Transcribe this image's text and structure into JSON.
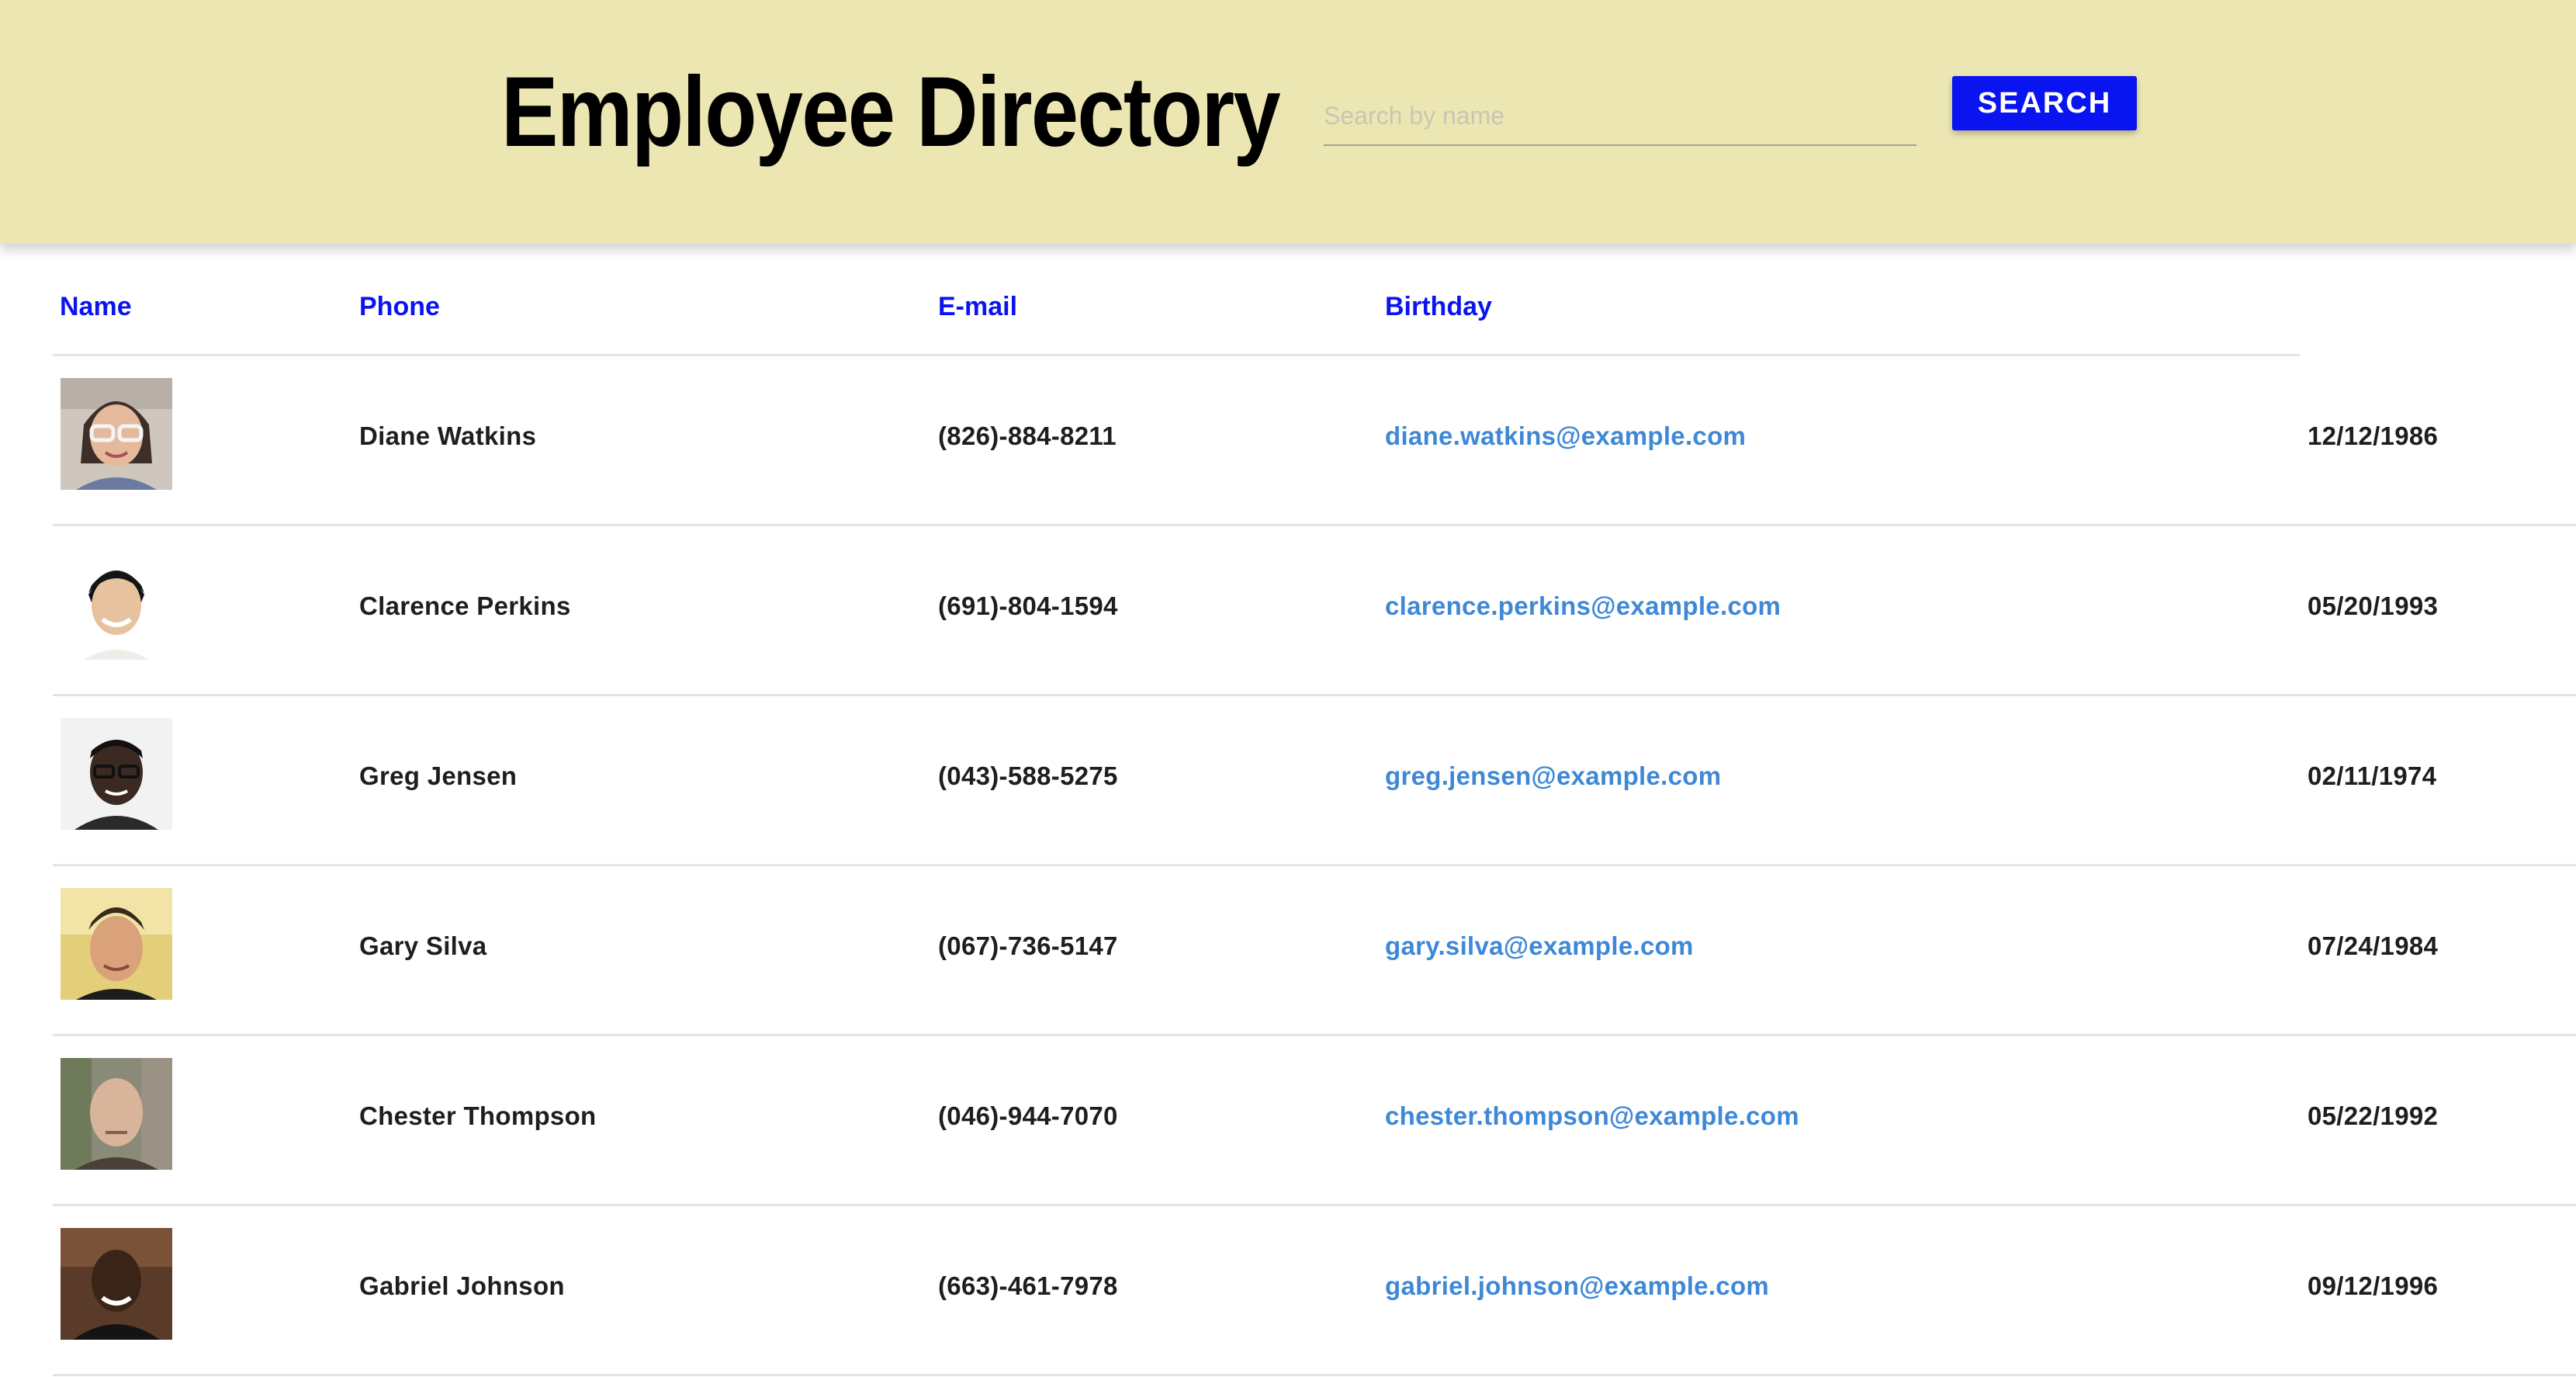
{
  "header": {
    "title": "Employee Directory",
    "search_placeholder": "Search by name",
    "search_value": "",
    "search_button_label": "SEARCH",
    "background_color": "#ece7b2",
    "button_color": "#0a14f0"
  },
  "table": {
    "columns": [
      "Name",
      "Phone",
      "E-mail",
      "Birthday"
    ],
    "header_color": "#0a14f0",
    "email_color": "#3e88d6",
    "rows": [
      {
        "name": "Diane Watkins",
        "phone": "(826)-884-8211",
        "email": "diane.watkins@example.com",
        "birthday": "12/12/1986",
        "avatar": "avatar-photo"
      },
      {
        "name": "Clarence Perkins",
        "phone": "(691)-804-1594",
        "email": "clarence.perkins@example.com",
        "birthday": "05/20/1993",
        "avatar": "avatar-photo"
      },
      {
        "name": "Greg Jensen",
        "phone": "(043)-588-5275",
        "email": "greg.jensen@example.com",
        "birthday": "02/11/1974",
        "avatar": "avatar-photo"
      },
      {
        "name": "Gary Silva",
        "phone": "(067)-736-5147",
        "email": "gary.silva@example.com",
        "birthday": "07/24/1984",
        "avatar": "avatar-photo"
      },
      {
        "name": "Chester Thompson",
        "phone": "(046)-944-7070",
        "email": "chester.thompson@example.com",
        "birthday": "05/22/1992",
        "avatar": "avatar-photo"
      },
      {
        "name": "Gabriel Johnson",
        "phone": "(663)-461-7978",
        "email": "gabriel.johnson@example.com",
        "birthday": "09/12/1996",
        "avatar": "avatar-photo"
      }
    ]
  }
}
